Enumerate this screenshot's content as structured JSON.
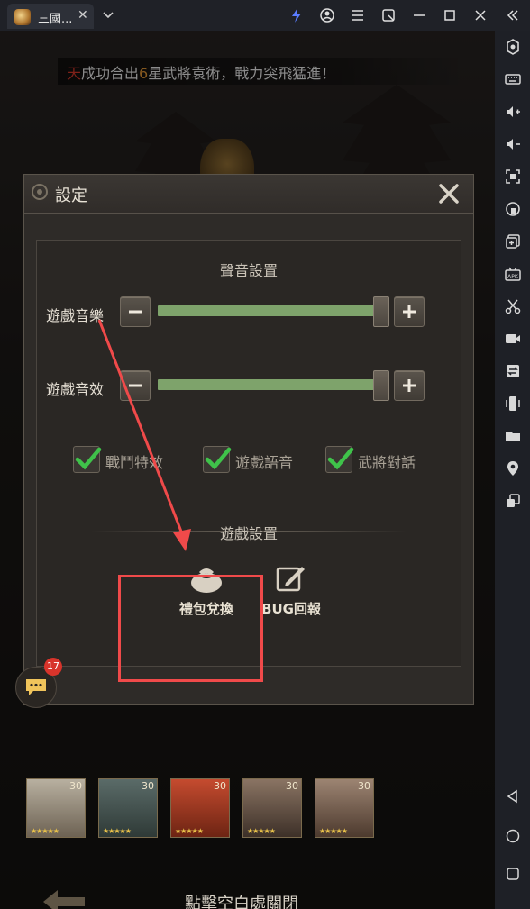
{
  "window": {
    "tab_title": "三國...",
    "tab_close": "✕",
    "title_icons": [
      "flash-icon",
      "account-icon",
      "menu-icon",
      "screenshot-icon",
      "minimize-icon",
      "maximize-icon",
      "close-icon",
      "collapse-icon"
    ]
  },
  "sidebar": {
    "icons": [
      "settings-icon",
      "keyboard-icon",
      "volume-up-icon",
      "volume-down-icon",
      "fullscreen-icon",
      "lock-icon",
      "add-window-icon",
      "apk-icon",
      "scissors-icon",
      "record-icon",
      "sync-icon",
      "shake-icon",
      "folder-icon",
      "location-icon",
      "multi-instance-icon",
      "back-icon",
      "home-icon",
      "recents-icon"
    ]
  },
  "notice": {
    "part1": "天",
    "part2": "成功合出",
    "part3": "6",
    "part4": "星武將袁術，戰力突飛猛進！"
  },
  "settings": {
    "title": "設定",
    "sound_section": "聲音設置",
    "music_label": "遊戲音樂",
    "effects_label": "遊戲音效",
    "music_level": 1.0,
    "effects_level": 1.0,
    "checks": [
      {
        "label": "戰鬥特效",
        "checked": true
      },
      {
        "label": "遊戲語音",
        "checked": true
      },
      {
        "label": "武將對話",
        "checked": true
      }
    ],
    "game_section": "遊戲設置",
    "gift_label": "禮包兌換",
    "bug_label": "BUG回報"
  },
  "chat": {
    "badge": "17"
  },
  "heroes": [
    {
      "level": "30",
      "stars": "★★★★★"
    },
    {
      "level": "30",
      "stars": "★★★★★"
    },
    {
      "level": "30",
      "stars": "★★★★★"
    },
    {
      "level": "30",
      "stars": "★★★★★"
    },
    {
      "level": "30",
      "stars": "★★★★★"
    }
  ],
  "footer": {
    "close_hint": "點擊空白處關閉"
  },
  "colors": {
    "slider_fill": "#7ea36b",
    "check_green": "#3fc24a",
    "highlight_red": "#f04a4a"
  }
}
